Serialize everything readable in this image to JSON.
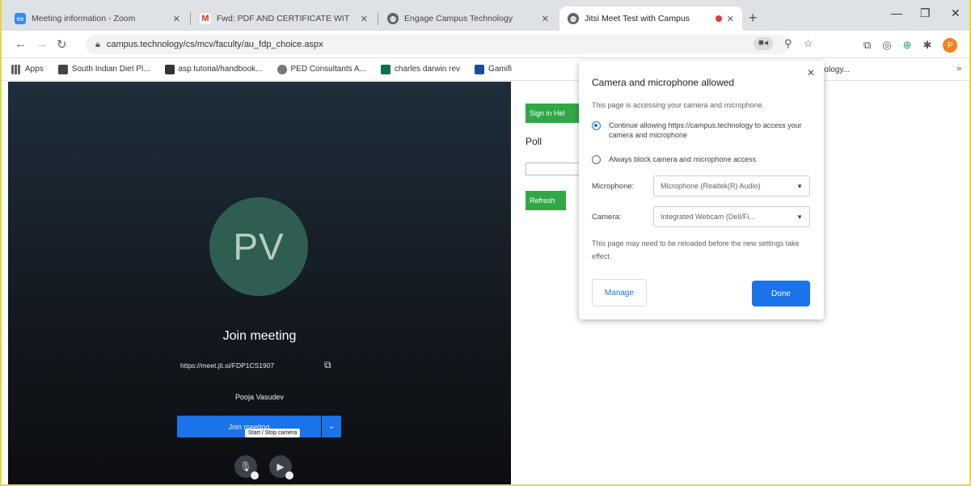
{
  "tabs": [
    {
      "label": "Meeting information - Zoom",
      "icon": "zoom-icon",
      "color": "#2d8cff"
    },
    {
      "label": "Fwd: PDF AND CERTIFICATE WIT",
      "icon": "gmail-icon",
      "color": "#d93025"
    },
    {
      "label": "Engage Campus Technology",
      "icon": "globe-icon",
      "color": "#5f6368"
    },
    {
      "label": "Jitsi Meet Test with Campus",
      "icon": "globe-icon",
      "color": "#5f6368",
      "active": true
    }
  ],
  "address": {
    "url": "campus.technology/cs/mcv/faculty/au_fdp_choice.aspx"
  },
  "bookmarks": [
    {
      "label": "Apps",
      "color": "#5f6368"
    },
    {
      "label": "South Indian Diet Pl...",
      "color": "#444"
    },
    {
      "label": "asp tutorial/handbook...",
      "color": "#333"
    },
    {
      "label": "PED Consultants A...",
      "color": "#777"
    },
    {
      "label": "charles darwin rev",
      "color": "#0b6e4f"
    },
    {
      "label": "Gamifi",
      "color": "#1a4b9c"
    }
  ],
  "bookmark_right": "nology...",
  "meeting": {
    "avatar_initials": "PV",
    "title": "Join meeting",
    "link": "https://meet.jit.si/FDP1CS1907",
    "user_name": "Pooja Vasudev",
    "join_label": "Join meeting",
    "tooltip": "Start / Stop camera"
  },
  "right": {
    "button1": "Sign in Hel",
    "poll_label": "Poll",
    "button2": "Refresh"
  },
  "popup": {
    "title": "Camera and microphone allowed",
    "subtitle": "This page is accessing your camera and microphone.",
    "option_allow": "Continue allowing https://campus.technology to access your camera and microphone",
    "option_block": "Always block camera and microphone access",
    "mic_label": "Microphone:",
    "mic_value": "Microphone (Realtek(R) Audio)",
    "cam_label": "Camera:",
    "cam_value": "Integrated Webcam (Dell/Fi...",
    "note": "This page may need to be reloaded before the new settings take effect.",
    "manage": "Manage",
    "done": "Done"
  }
}
